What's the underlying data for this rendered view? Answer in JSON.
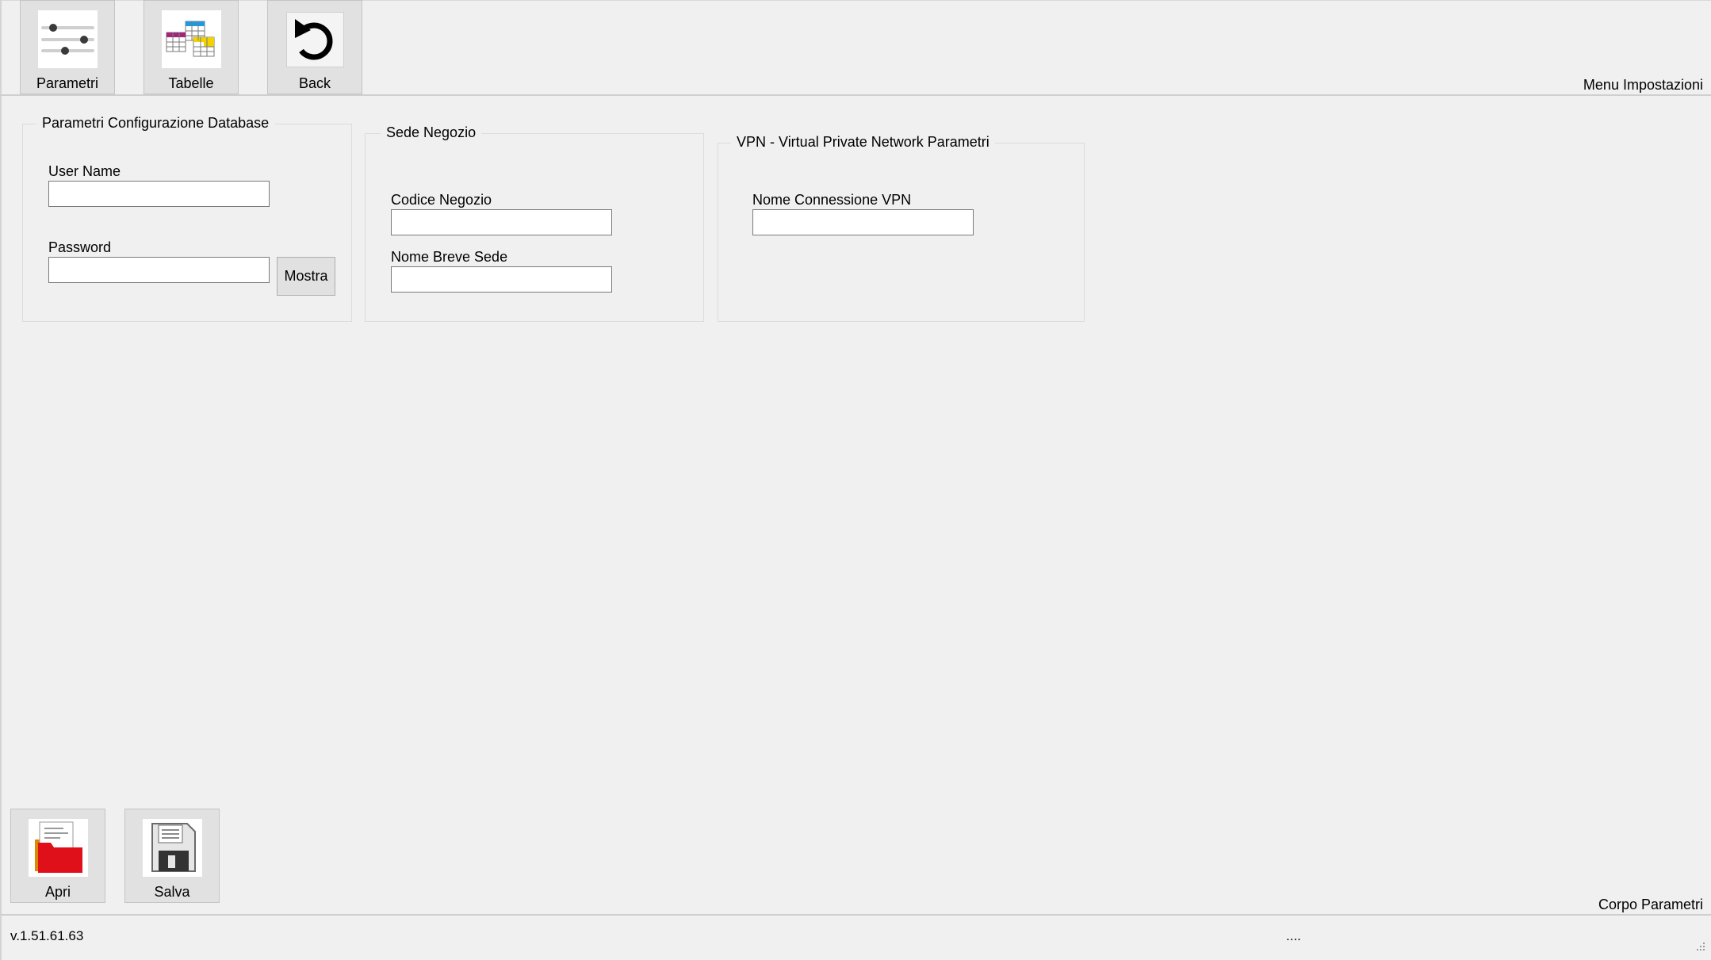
{
  "toolbar": {
    "parametri_label": "Parametri",
    "tabelle_label": "Tabelle",
    "back_label": "Back",
    "section_label": "Menu Impostazioni"
  },
  "database_group": {
    "title": "Parametri Configurazione Database",
    "username_label": "User Name",
    "username_value": "",
    "password_label": "Password",
    "password_value": "",
    "show_button_label": "Mostra"
  },
  "store_group": {
    "title": "Sede Negozio",
    "code_label": "Codice Negozio",
    "code_value": "",
    "short_name_label": "Nome Breve Sede",
    "short_name_value": ""
  },
  "vpn_group": {
    "title": "VPN - Virtual Private Network Parametri",
    "connection_label": "Nome Connessione VPN",
    "connection_value": ""
  },
  "bottom_toolbar": {
    "open_label": "Apri",
    "save_label": "Salva",
    "section_label": "Corpo Parametri"
  },
  "statusbar": {
    "version": "v.1.51.61.63",
    "status": "...."
  },
  "icons": [
    "sliders-icon",
    "tables-icon",
    "back-arrow-icon",
    "open-folder-icon",
    "floppy-disk-icon",
    "resize-grip-icon"
  ]
}
